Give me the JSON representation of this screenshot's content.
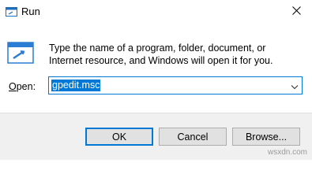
{
  "window": {
    "title": "Run",
    "icon": "run-app-icon",
    "close_icon": "close-icon"
  },
  "dialog": {
    "message": "Type the name of a program, folder, document, or Internet resource, and Windows will open it for you.",
    "open_label_accel": "O",
    "open_label_rest": "pen:",
    "open_value": "gpedit.msc",
    "dropdown_icon": "chevron-down-icon"
  },
  "buttons": {
    "ok": "OK",
    "cancel": "Cancel",
    "browse": "Browse..."
  },
  "watermark": "wsxdn.com",
  "colors": {
    "accent": "#0078d7",
    "footer_bg": "#f0f0f0",
    "button_bg": "#e1e1e1"
  }
}
